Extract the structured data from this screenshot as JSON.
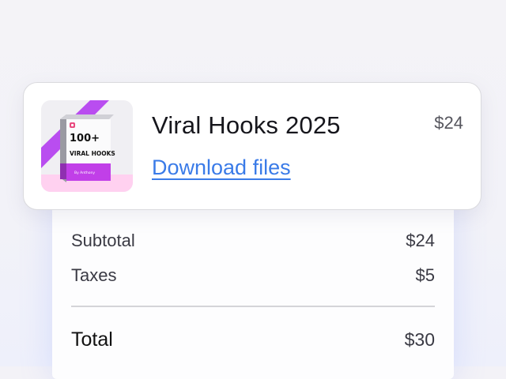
{
  "item": {
    "title": "Viral Hooks 2025",
    "link_label": "Download files",
    "price": "$24",
    "thumbnail": {
      "count_text": "100+",
      "subtitle": "VIRAL HOOKS",
      "author": "By Anthony",
      "icon": "instagram-icon",
      "accent_color": "#b94df0"
    }
  },
  "summary": {
    "subtotal_label": "Subtotal",
    "subtotal_value": "$24",
    "taxes_label": "Taxes",
    "taxes_value": "$5",
    "total_label": "Total",
    "total_value": "$30"
  },
  "colors": {
    "link": "#3a7be8",
    "card_border": "#dadade"
  }
}
